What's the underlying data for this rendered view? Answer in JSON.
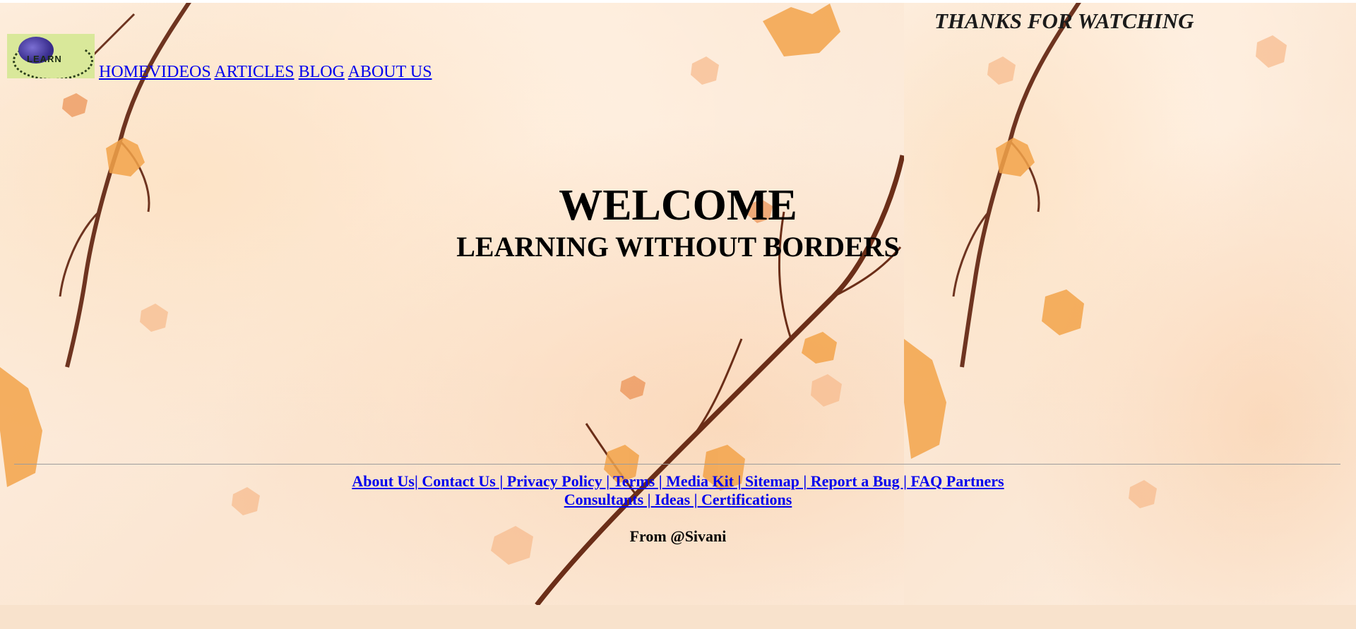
{
  "logo": {
    "text": "LEARN"
  },
  "nav": {
    "items": [
      {
        "label": "HOME"
      },
      {
        "label": "VIDEOS"
      },
      {
        "label": "ARTICLES"
      },
      {
        "label": "BLOG"
      },
      {
        "label": "ABOUT US"
      }
    ]
  },
  "aside": {
    "thanks": "THANKS FOR WATCHING"
  },
  "hero": {
    "title": "WELCOME",
    "subtitle": "LEARNING WITHOUT BORDERS"
  },
  "footer": {
    "links": [
      {
        "label": "About Us|"
      },
      {
        "label": " Contact Us |"
      },
      {
        "label": " Privacy Policy |"
      },
      {
        "label": " Terms |"
      },
      {
        "label": " Media Kit |"
      },
      {
        "label": " Sitemap |"
      },
      {
        "label": " Report a Bug |"
      },
      {
        "label": " FAQ"
      },
      {
        "label": " Partners"
      },
      {
        "label": "Consultants |"
      },
      {
        "label": " Ideas |"
      },
      {
        "label": " Certifications"
      }
    ],
    "credit": "From @Sivani"
  },
  "colors": {
    "link": "#0000ee",
    "background": "#fbeee2",
    "logo_bg": "#d9e89a"
  }
}
